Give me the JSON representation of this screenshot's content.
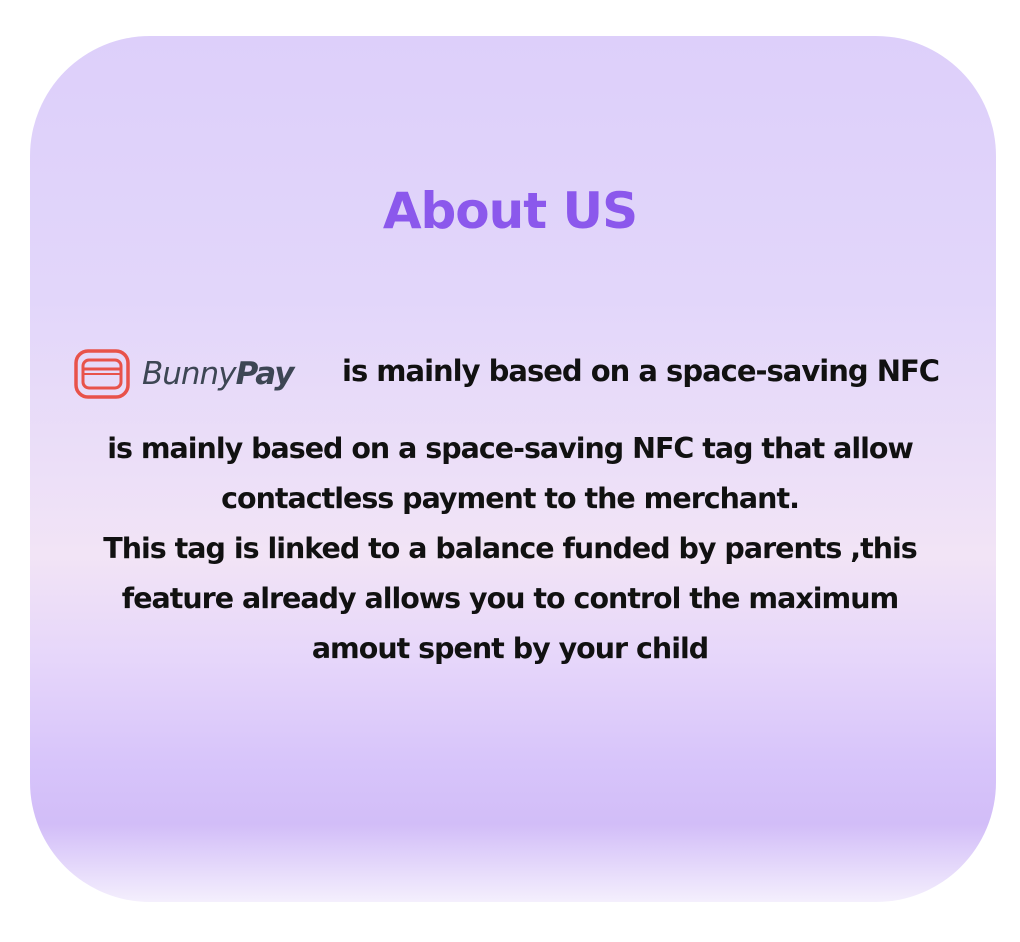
{
  "title": "About US",
  "brand": {
    "name_part1": "Bunny",
    "name_part2": "Pay",
    "icon": "card-icon",
    "tagline": "is mainly based on a space-saving NFC"
  },
  "description_lines": [
    "is mainly based on a space-saving NFC tag that allow",
    "contactless payment to the merchant.",
    "This tag is linked to a balance funded by parents ,this",
    "feature already allows you to control the maximum",
    "amout spent by your child"
  ],
  "colors": {
    "title": "#8b58ec",
    "logo_accent": "#e8524a",
    "logo_text": "#3d4654"
  }
}
